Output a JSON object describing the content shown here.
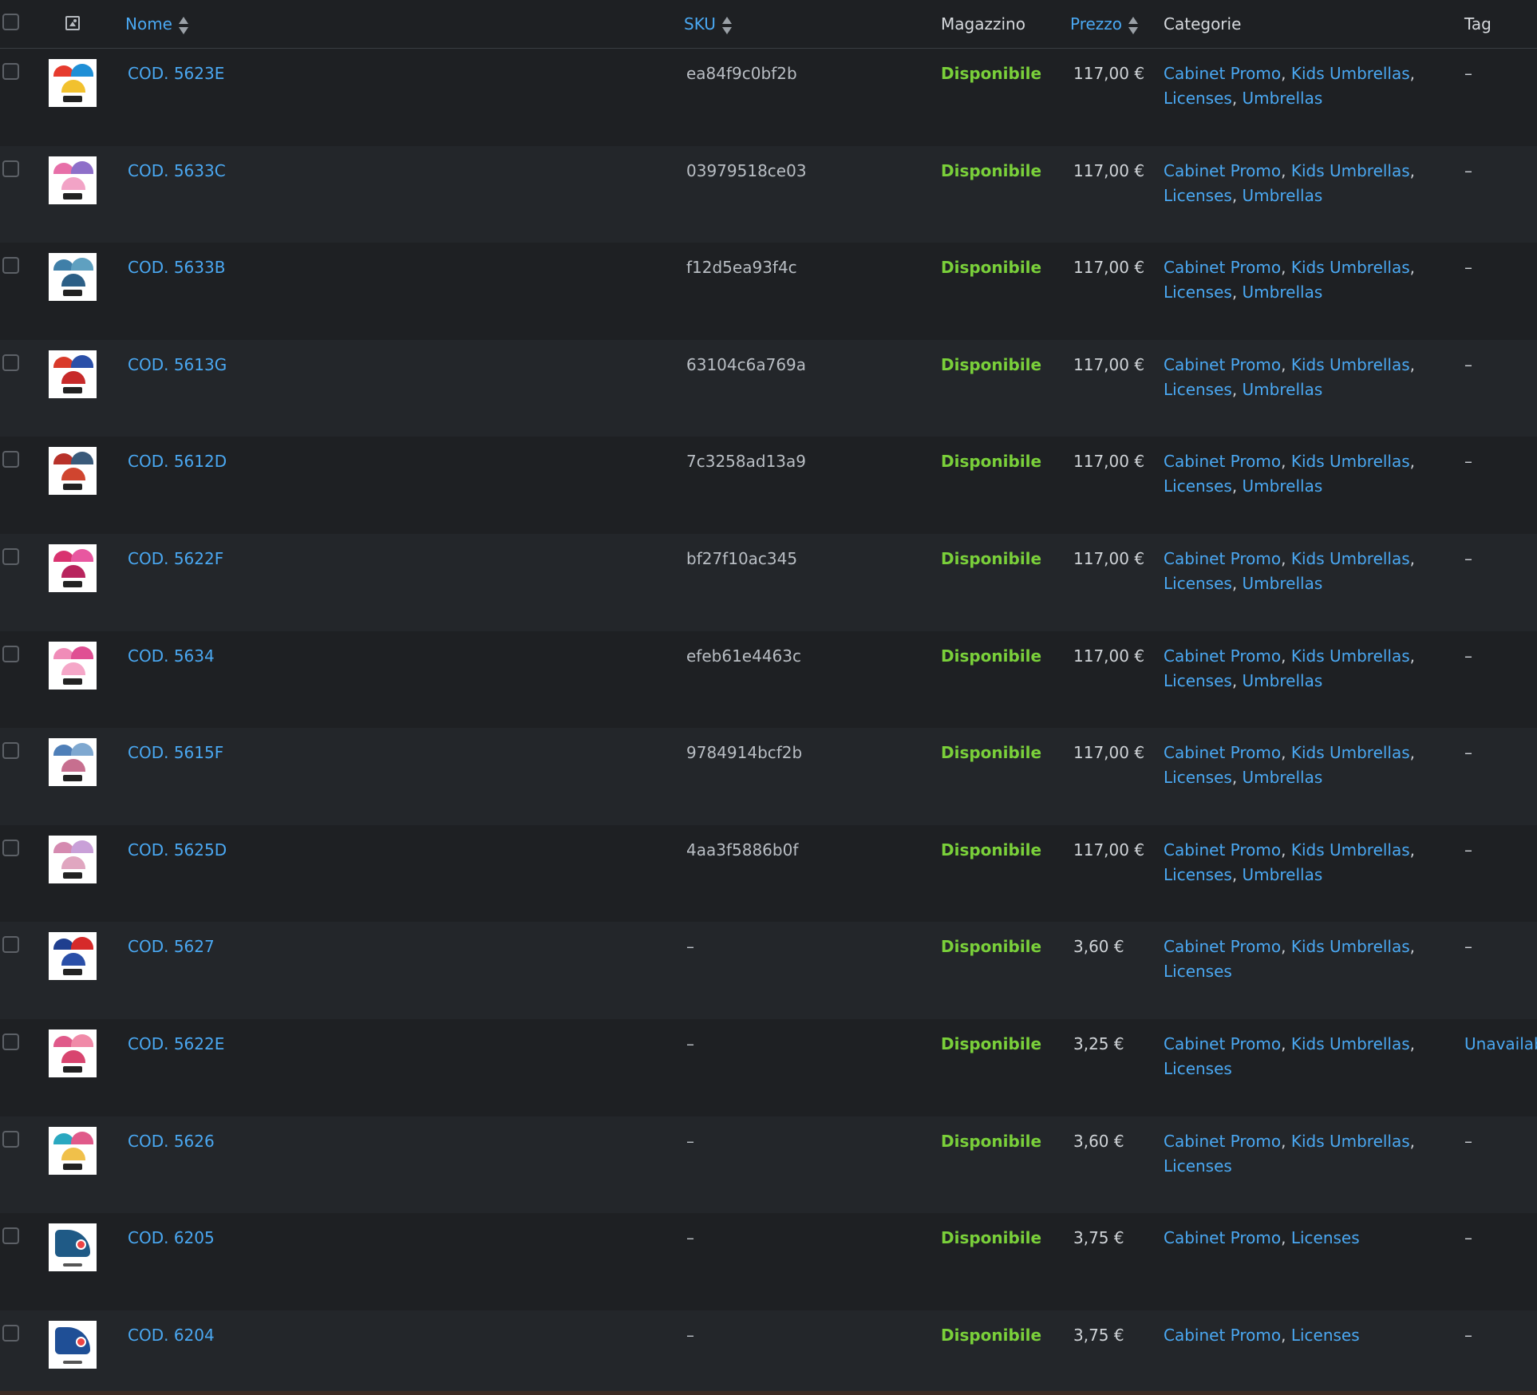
{
  "header": {
    "name": "Nome",
    "sku": "SKU",
    "stock": "Magazzino",
    "price": "Prezzo",
    "categories": "Categorie",
    "tag": "Tag"
  },
  "colors": {
    "link": "#4aa8f2",
    "in_stock": "#7ad03a",
    "bg": "#1e2023",
    "row_alt": "#23262a"
  },
  "rows": [
    {
      "name": "COD. 5623E",
      "sku": "ea84f9c0bf2b",
      "stock": "Disponibile",
      "price": "117,00 €",
      "cats": [
        "Cabinet Promo",
        "Kids Umbrellas",
        "Licenses",
        "Umbrellas"
      ],
      "tag": "–",
      "thumb": [
        "#e63b2e",
        "#1f8fd6",
        "#f2c12e"
      ]
    },
    {
      "name": "COD. 5633C",
      "sku": "03979518ce03",
      "stock": "Disponibile",
      "price": "117,00 €",
      "cats": [
        "Cabinet Promo",
        "Kids Umbrellas",
        "Licenses",
        "Umbrellas"
      ],
      "tag": "–",
      "thumb": [
        "#e76fa8",
        "#8e6fc9",
        "#f2a3c6"
      ]
    },
    {
      "name": "COD. 5633B",
      "sku": "f12d5ea93f4c",
      "stock": "Disponibile",
      "price": "117,00 €",
      "cats": [
        "Cabinet Promo",
        "Kids Umbrellas",
        "Licenses",
        "Umbrellas"
      ],
      "tag": "–",
      "thumb": [
        "#3f7fa8",
        "#5fa0c0",
        "#2c5f86"
      ]
    },
    {
      "name": "COD. 5613G",
      "sku": "63104c6a769a",
      "stock": "Disponibile",
      "price": "117,00 €",
      "cats": [
        "Cabinet Promo",
        "Kids Umbrellas",
        "Licenses",
        "Umbrellas"
      ],
      "tag": "–",
      "thumb": [
        "#d93a2a",
        "#2a4fa8",
        "#c72a2a"
      ]
    },
    {
      "name": "COD. 5612D",
      "sku": "7c3258ad13a9",
      "stock": "Disponibile",
      "price": "117,00 €",
      "cats": [
        "Cabinet Promo",
        "Kids Umbrellas",
        "Licenses",
        "Umbrellas"
      ],
      "tag": "–",
      "thumb": [
        "#b8322a",
        "#3a5a7a",
        "#d0452f"
      ]
    },
    {
      "name": "COD. 5622F",
      "sku": "bf27f10ac345",
      "stock": "Disponibile",
      "price": "117,00 €",
      "cats": [
        "Cabinet Promo",
        "Kids Umbrellas",
        "Licenses",
        "Umbrellas"
      ],
      "tag": "–",
      "thumb": [
        "#d9326f",
        "#e857a0",
        "#b8245d"
      ]
    },
    {
      "name": "COD. 5634",
      "sku": "efeb61e4463c",
      "stock": "Disponibile",
      "price": "117,00 €",
      "cats": [
        "Cabinet Promo",
        "Kids Umbrellas",
        "Licenses",
        "Umbrellas"
      ],
      "tag": "–",
      "thumb": [
        "#f08cb8",
        "#e04f93",
        "#f5a7c8"
      ]
    },
    {
      "name": "COD. 5615F",
      "sku": "9784914bcf2b",
      "stock": "Disponibile",
      "price": "117,00 €",
      "cats": [
        "Cabinet Promo",
        "Kids Umbrellas",
        "Licenses",
        "Umbrellas"
      ],
      "tag": "–",
      "thumb": [
        "#4f7fb8",
        "#7fa8d0",
        "#c76f8f"
      ]
    },
    {
      "name": "COD. 5625D",
      "sku": "4aa3f5886b0f",
      "stock": "Disponibile",
      "price": "117,00 €",
      "cats": [
        "Cabinet Promo",
        "Kids Umbrellas",
        "Licenses",
        "Umbrellas"
      ],
      "tag": "–",
      "thumb": [
        "#d58ab0",
        "#c9a0d8",
        "#e0a6c0"
      ]
    },
    {
      "name": "COD. 5627",
      "sku": "–",
      "stock": "Disponibile",
      "price": "3,60 €",
      "cats": [
        "Cabinet Promo",
        "Kids Umbrellas",
        "Licenses"
      ],
      "tag": "–",
      "thumb": [
        "#1f3f8f",
        "#d62a2a",
        "#2a4fa8"
      ]
    },
    {
      "name": "COD. 5622E",
      "sku": "–",
      "stock": "Disponibile",
      "price": "3,25 €",
      "cats": [
        "Cabinet Promo",
        "Kids Umbrellas",
        "Licenses"
      ],
      "tag": "Unavailable",
      "tag_link": true,
      "thumb": [
        "#e05a8a",
        "#f08aa8",
        "#d8456f"
      ]
    },
    {
      "name": "COD. 5626",
      "sku": "–",
      "stock": "Disponibile",
      "price": "3,60 €",
      "cats": [
        "Cabinet Promo",
        "Kids Umbrellas",
        "Licenses"
      ],
      "tag": "–",
      "thumb": [
        "#2aa8c0",
        "#e05a8a",
        "#f0c04a"
      ]
    },
    {
      "name": "COD. 6205",
      "sku": "–",
      "stock": "Disponibile",
      "price": "3,75 €",
      "cats": [
        "Cabinet Promo",
        "Licenses"
      ],
      "tag": "–",
      "thumb": [
        "#1f5a86",
        "#1f5a86",
        "#1f5a86"
      ],
      "fold": true
    },
    {
      "name": "COD. 6204",
      "sku": "–",
      "stock": "Disponibile",
      "price": "3,75 €",
      "cats": [
        "Cabinet Promo",
        "Licenses"
      ],
      "tag": "–",
      "thumb": [
        "#1f4f96",
        "#1f4f96",
        "#1f4f96"
      ],
      "fold": true
    }
  ]
}
